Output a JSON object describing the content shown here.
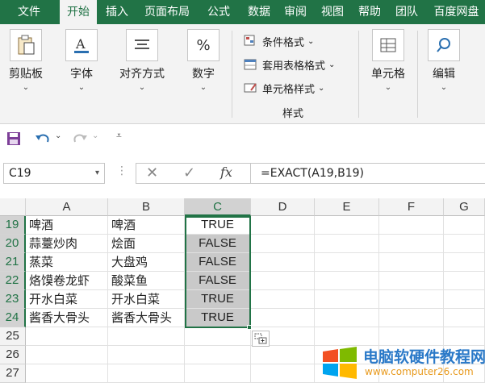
{
  "tabs": [
    "文件",
    "开始",
    "插入",
    "页面布局",
    "公式",
    "数据",
    "审阅",
    "视图",
    "帮助",
    "团队",
    "百度网盘"
  ],
  "active_tab": "开始",
  "ribbon": {
    "clipboard": "剪贴板",
    "font": "字体",
    "alignment": "对齐方式",
    "number": "数字",
    "conditional_format": "条件格式",
    "table_format": "套用表格格式",
    "cell_style": "单元格样式",
    "styles_group": "样式",
    "cells": "单元格",
    "editing": "编辑"
  },
  "formula_bar": {
    "name_box": "C19",
    "formula": "=EXACT(A19,B19)"
  },
  "columns": [
    "A",
    "B",
    "C",
    "D",
    "E",
    "F",
    "G"
  ],
  "selected_column": "C",
  "rows": [
    {
      "num": "19",
      "a": "啤酒",
      "b": "啤酒",
      "c": "TRUE"
    },
    {
      "num": "20",
      "a": "蒜薹炒肉",
      "b": "烩面",
      "c": "FALSE"
    },
    {
      "num": "21",
      "a": "蒸菜",
      "b": "大盘鸡",
      "c": "FALSE"
    },
    {
      "num": "22",
      "a": "烙馍卷龙虾",
      "b": "酸菜鱼",
      "c": "FALSE"
    },
    {
      "num": "23",
      "a": "开水白菜",
      "b": "开水白菜",
      "c": "TRUE"
    },
    {
      "num": "24",
      "a": "酱香大骨头",
      "b": "酱香大骨头",
      "c": "TRUE"
    },
    {
      "num": "25",
      "a": "",
      "b": "",
      "c": ""
    },
    {
      "num": "26",
      "a": "",
      "b": "",
      "c": ""
    },
    {
      "num": "27",
      "a": "",
      "b": "",
      "c": ""
    }
  ],
  "watermark": {
    "title": "电脑软硬件教程网",
    "url": "www.computer26.com"
  },
  "colors": {
    "accent": "#217346",
    "selection_fill": "#c9c9c9"
  }
}
